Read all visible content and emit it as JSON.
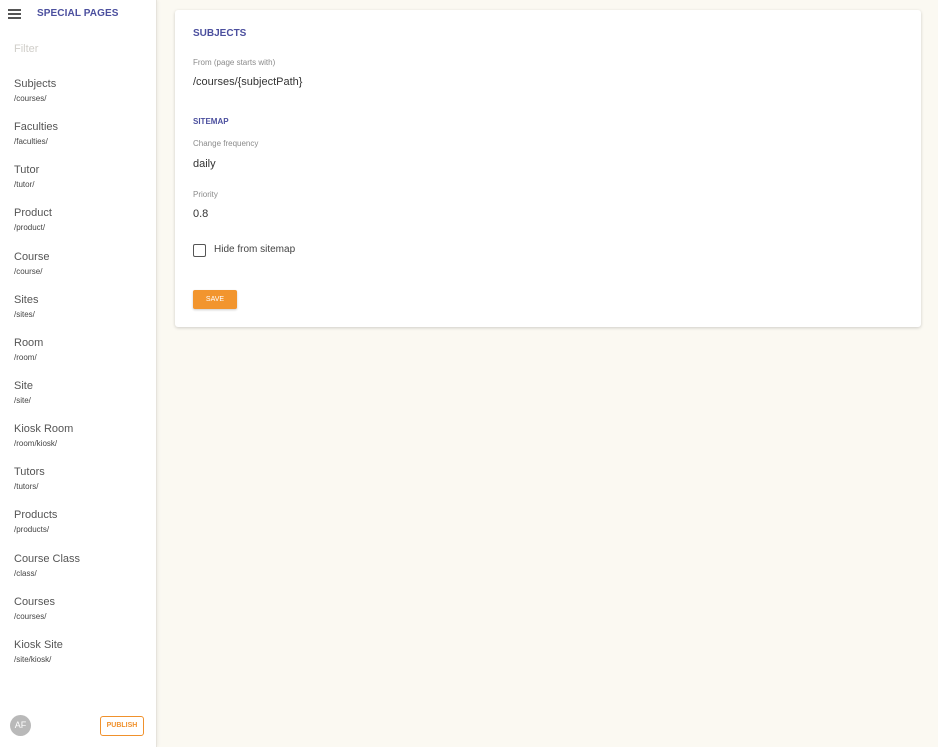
{
  "sidebar": {
    "title": "SPECIAL PAGES",
    "filter_placeholder": "Filter",
    "items": [
      {
        "label": "Subjects",
        "path": "/courses/"
      },
      {
        "label": "Faculties",
        "path": "/faculties/"
      },
      {
        "label": "Tutor",
        "path": "/tutor/"
      },
      {
        "label": "Product",
        "path": "/product/"
      },
      {
        "label": "Course",
        "path": "/course/"
      },
      {
        "label": "Sites",
        "path": "/sites/"
      },
      {
        "label": "Room",
        "path": "/room/"
      },
      {
        "label": "Site",
        "path": "/site/"
      },
      {
        "label": "Kiosk Room",
        "path": "/room/kiosk/"
      },
      {
        "label": "Tutors",
        "path": "/tutors/"
      },
      {
        "label": "Products",
        "path": "/products/"
      },
      {
        "label": "Course Class",
        "path": "/class/"
      },
      {
        "label": "Courses",
        "path": "/courses/"
      },
      {
        "label": "Kiosk Site",
        "path": "/site/kiosk/"
      }
    ],
    "footer": {
      "avatar_initials": "AF",
      "publish_label": "PUBLISH"
    }
  },
  "main": {
    "title": "SUBJECTS",
    "from_label": "From (page starts with)",
    "from_value": "/courses/{subjectPath}",
    "sitemap": {
      "title": "SITEMAP",
      "change_frequency_label": "Change frequency",
      "change_frequency_value": "daily",
      "priority_label": "Priority",
      "priority_value": "0.8",
      "hide_label": "Hide from sitemap",
      "hide_checked": false
    },
    "save_label": "SAVE"
  },
  "colors": {
    "accent": "#4b4f9e",
    "orange": "#f2952e",
    "background": "#fbf9f2"
  }
}
